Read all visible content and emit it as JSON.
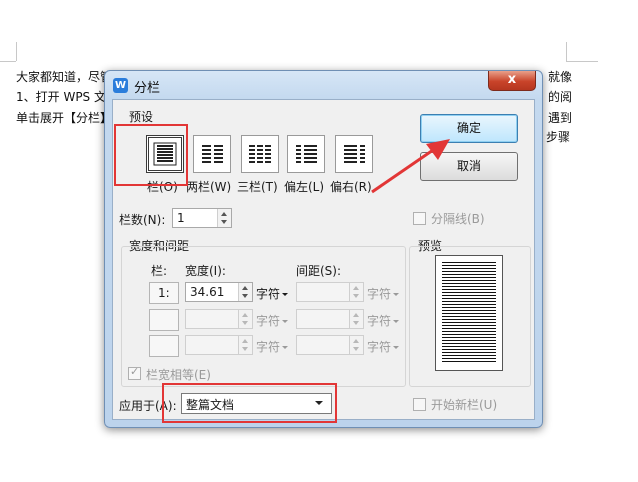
{
  "document": {
    "lines": [
      "大家都知道，尽管在 WPS",
      "1、打开 WPS 文",
      "单击展开【分栏】"
    ],
    "right_lines": [
      "就像",
      "的阅",
      "遇到",
      "步骤"
    ]
  },
  "dialog": {
    "title": "分栏",
    "app_icon": "W",
    "close_symbol": "x",
    "presets_label": "预设",
    "presets": [
      {
        "label": "栏(O)"
      },
      {
        "label": "两栏(W)"
      },
      {
        "label": "三栏(T)"
      },
      {
        "label": "偏左(L)"
      },
      {
        "label": "偏右(R)"
      }
    ],
    "ok_label": "确定",
    "cancel_label": "取消",
    "columns_count_label": "栏数(N):",
    "columns_count_value": "1",
    "divider_label": "分隔线(B)",
    "width_spacing_label": "宽度和间距",
    "col_header": "栏:",
    "width_header": "宽度(I):",
    "spacing_header": "间距(S):",
    "rows": [
      {
        "num": "1:",
        "width": "34.61",
        "unit": "字符"
      },
      {
        "num": "",
        "width": "",
        "unit": "字符"
      },
      {
        "num": "",
        "width": "",
        "unit": "字符"
      }
    ],
    "spacing_unit": "字符",
    "equal_width_label": "栏宽相等(E)",
    "apply_label": "应用于(A):",
    "apply_value": "整篇文档",
    "preview_label": "预览",
    "new_column_label": "开始新栏(U)"
  },
  "colors": {
    "annotation": "#e23636",
    "title_bar": "#c4d9ef",
    "close": "#c9442a"
  }
}
